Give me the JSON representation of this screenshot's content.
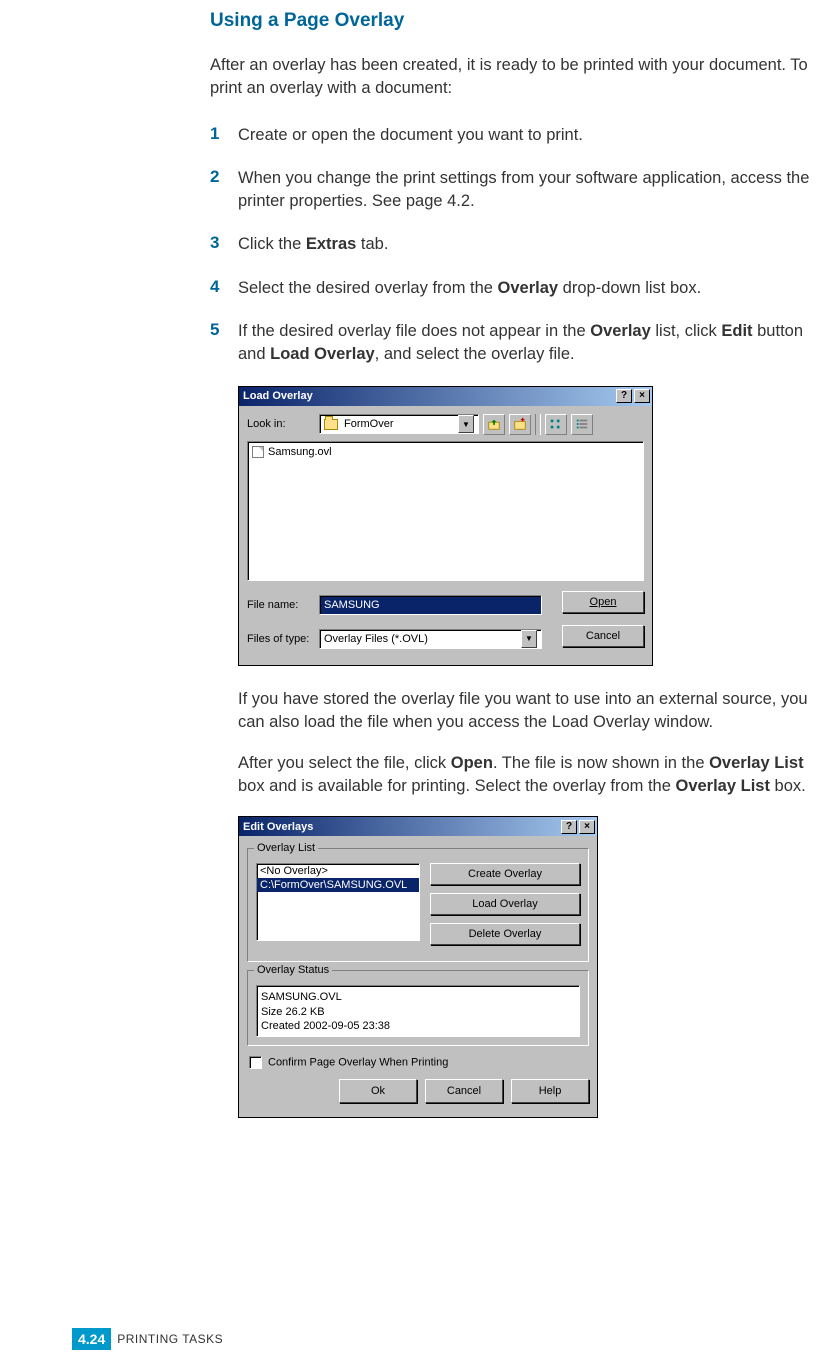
{
  "heading": "Using a Page Overlay",
  "intro": "After an overlay has been created, it is ready to be printed with your document. To print an overlay with a document:",
  "steps": {
    "s1": {
      "num": "1",
      "text": "Create or open the document you want to print."
    },
    "s2": {
      "num": "2",
      "text": "When you change the print settings from your software application, access the printer properties. See page 4.2."
    },
    "s3": {
      "num": "3",
      "pre": "Click the ",
      "b1": "Extras",
      "post": " tab."
    },
    "s4": {
      "num": "4",
      "pre": "Select the desired overlay from the ",
      "b1": "Overlay",
      "post": " drop-down list box."
    },
    "s5": {
      "num": "5",
      "t1": "If the desired overlay file does not appear in the ",
      "b1": "Overlay",
      "t2": " list, click ",
      "b2": "Edit",
      "t3": " button and ",
      "b3": "Load Overlay",
      "t4": ", and select the overlay file."
    }
  },
  "sub1": "If you have stored the overlay file you want to use into an external source, you can also load the file when you access the Load Overlay window.",
  "sub2": {
    "t1": "After you select the file, click ",
    "b1": "Open",
    "t2": ". The file is now shown in the ",
    "b2": "Overlay List",
    "t3": " box and is available for printing. Select the overlay from the ",
    "b3": "Overlay List",
    "t4": " box."
  },
  "loadDialog": {
    "title": "Load Overlay",
    "help": "?",
    "close": "×",
    "lookInLabel": "Look in:",
    "lookInValue": "FormOver",
    "fileItem": "Samsung.ovl",
    "fileNameLabel": "File name:",
    "fileNameValue": "SAMSUNG",
    "filesOfTypeLabel": "Files of type:",
    "filesOfTypeValue": "Overlay Files (*.OVL)",
    "openBtn": "Open",
    "cancelBtn": "Cancel"
  },
  "editDialog": {
    "title": "Edit Overlays",
    "help": "?",
    "close": "×",
    "groupListLabel": "Overlay List",
    "listItems": {
      "i0": "<No Overlay>",
      "i1": "C:\\FormOver\\SAMSUNG.OVL"
    },
    "createBtn": "Create Overlay",
    "loadBtn": "Load Overlay",
    "deleteBtn": "Delete Overlay",
    "groupStatusLabel": "Overlay Status",
    "status": {
      "l1": "SAMSUNG.OVL",
      "l2": "Size 26.2 KB",
      "l3": "Created 2002-09-05 23:38"
    },
    "confirmLabel": "Confirm Page Overlay When Printing",
    "okBtn": "Ok",
    "cancelBtn": "Cancel",
    "helpBtn": "Help"
  },
  "footer": {
    "pageNum": "4.24",
    "section": "PRINTING TASKS"
  }
}
